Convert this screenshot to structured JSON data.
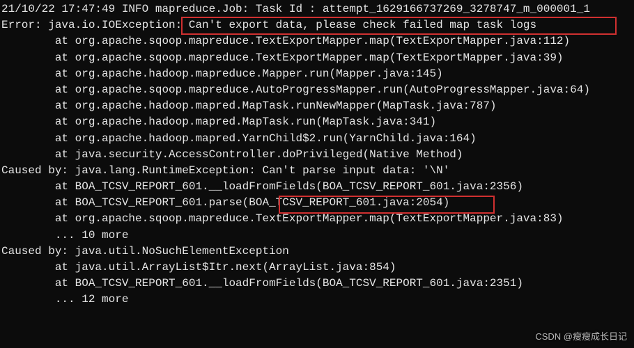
{
  "lines": [
    "21/10/22 17:47:49 INFO mapreduce.Job: Task Id : attempt_1629166737269_3278747_m_000001_1",
    "Error: java.io.IOException: Can't export data, please check failed map task logs",
    "        at org.apache.sqoop.mapreduce.TextExportMapper.map(TextExportMapper.java:112)",
    "        at org.apache.sqoop.mapreduce.TextExportMapper.map(TextExportMapper.java:39)",
    "        at org.apache.hadoop.mapreduce.Mapper.run(Mapper.java:145)",
    "        at org.apache.sqoop.mapreduce.AutoProgressMapper.run(AutoProgressMapper.java:64)",
    "        at org.apache.hadoop.mapred.MapTask.runNewMapper(MapTask.java:787)",
    "        at org.apache.hadoop.mapred.MapTask.run(MapTask.java:341)",
    "        at org.apache.hadoop.mapred.YarnChild$2.run(YarnChild.java:164)",
    "        at java.security.AccessController.doPrivileged(Native Method)",
    "Caused by: java.lang.RuntimeException: Can't parse input data: '\\N'",
    "        at BOA_TCSV_REPORT_601.__loadFromFields(BOA_TCSV_REPORT_601.java:2356)",
    "        at BOA_TCSV_REPORT_601.parse(BOA_TCSV_REPORT_601.java:2054)",
    "        at org.apache.sqoop.mapreduce.TextExportMapper.map(TextExportMapper.java:83)",
    "        ... 10 more",
    "",
    "Caused by: java.util.NoSuchElementException",
    "        at java.util.ArrayList$Itr.next(ArrayList.java:854)",
    "        at BOA_TCSV_REPORT_601.__loadFromFields(BOA_TCSV_REPORT_601.java:2351)",
    "        ... 12 more"
  ],
  "highlights": {
    "box1_target": "Can't export data, please check failed map task logs",
    "box2_target": "Can't parse input data: '\\N'"
  },
  "watermark": "CSDN @瘦瘦成长日记"
}
